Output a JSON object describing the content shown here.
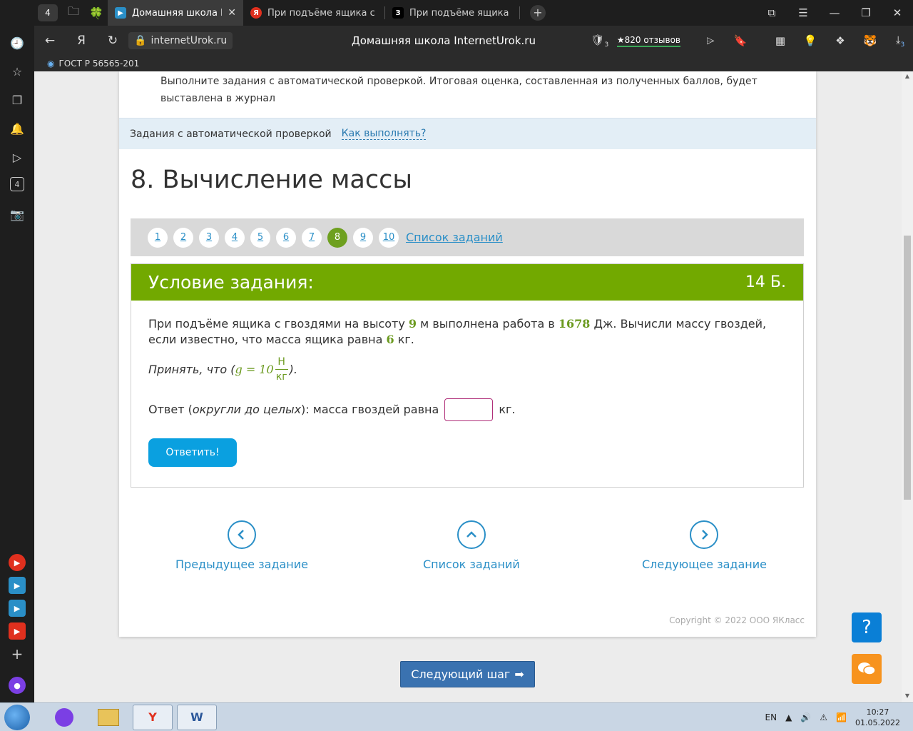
{
  "browser": {
    "tab_count": "4",
    "tabs": [
      {
        "title": "Домашняя школа Inter",
        "favicon": "▶",
        "color": "#2a8fc7"
      },
      {
        "title": "При подъёме ящика с гво",
        "favicon": "Я",
        "color": "#e0301e"
      },
      {
        "title": "При подъёме ящика с гво",
        "favicon": "З",
        "color": "#000000"
      }
    ],
    "url": "internetUrok.ru",
    "page_title": "Домашняя школа InternetUrok.ru",
    "reviews": "★820 отзывов",
    "shield_badge": "3",
    "download_badge": "3",
    "bookmark": "ГОСТ Р 56565-201",
    "left_panel_badge": "4"
  },
  "page": {
    "intro": "Выполните задания с автоматической проверкой. Итоговая оценка, составленная из полученных баллов, будет выставлена в журнал",
    "auto_label": "Задания с автоматической проверкой",
    "how_link": "Как выполнять?",
    "heading": "8. Вычисление массы",
    "task_numbers": [
      "1",
      "2",
      "3",
      "4",
      "5",
      "6",
      "7",
      "8",
      "9",
      "10"
    ],
    "active_task": "8",
    "task_list_link": "Список заданий",
    "condition_title": "Условие задания:",
    "points": "14 Б.",
    "problem": {
      "p1": "При подъёме ящика с гвоздями на высоту",
      "height": "9",
      "p2": "м выполнена работа в",
      "work": "1678",
      "p3": "Дж. Вычисли массу гвоздей, если известно, что масса ящика равна",
      "box_mass": "6",
      "p4": "кг."
    },
    "hint": {
      "prefix": "Принять, что (",
      "formula": "g = 10",
      "num": "Н",
      "den": "кг",
      "suffix": ")."
    },
    "answer": {
      "label_prefix": "Ответ (",
      "label_italic": "округли до целых",
      "label_suffix": "): масса гвоздей равна",
      "unit": "кг.",
      "value": ""
    },
    "submit": "Ответить!",
    "prev": "Предыдущее задание",
    "list": "Список заданий",
    "next": "Следующее задание",
    "copyright": "Copyright © 2022 ООО ЯКласс",
    "help": "?",
    "next_step": "Следующий шаг"
  },
  "taskbar": {
    "lang": "EN",
    "time": "10:27",
    "date": "01.05.2022"
  }
}
